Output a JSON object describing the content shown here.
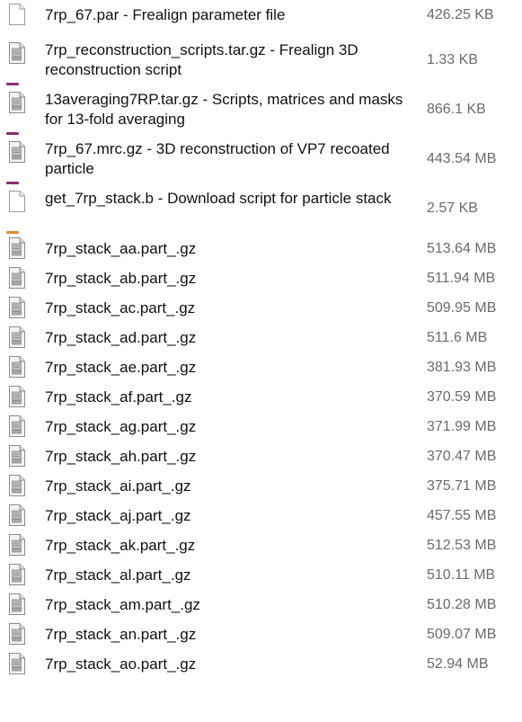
{
  "colors": {
    "text": "#111111",
    "size_text": "#6b6b6b",
    "mark_purple": "#8e2b73",
    "mark_orange": "#e08a2c"
  },
  "files": [
    {
      "name": "7rp_67.par - Frealign parameter file",
      "size": "426.25 KB",
      "icon": "blank-document-icon",
      "layout": "first",
      "mark": ""
    },
    {
      "name": "7rp_reconstruction_scripts.tar.gz - Frealign 3D reconstruction script",
      "size": "1.33 KB",
      "icon": "archive-file-icon",
      "layout": "double",
      "mark": "purple"
    },
    {
      "name": "13averaging7RP.tar.gz - Scripts, matrices and masks for 13-fold averaging",
      "size": "866.1 KB",
      "icon": "archive-file-icon",
      "layout": "double",
      "mark": "purple"
    },
    {
      "name": "7rp_67.mrc.gz - 3D reconstruction of VP7 recoated particle",
      "size": "443.54 MB",
      "icon": "archive-file-icon",
      "layout": "double",
      "mark": "purple"
    },
    {
      "name": "get_7rp_stack.b - Download script for particle stack",
      "size": "2.57 KB",
      "icon": "blank-document-icon",
      "layout": "double",
      "mark": "orange"
    },
    {
      "name": "7rp_stack_aa.part_.gz",
      "size": "513.64 MB",
      "icon": "archive-file-icon",
      "layout": "single",
      "mark": ""
    },
    {
      "name": "7rp_stack_ab.part_.gz",
      "size": "511.94 MB",
      "icon": "archive-file-icon",
      "layout": "single",
      "mark": ""
    },
    {
      "name": "7rp_stack_ac.part_.gz",
      "size": "509.95 MB",
      "icon": "archive-file-icon",
      "layout": "single",
      "mark": ""
    },
    {
      "name": "7rp_stack_ad.part_.gz",
      "size": "511.6 MB",
      "icon": "archive-file-icon",
      "layout": "single",
      "mark": ""
    },
    {
      "name": "7rp_stack_ae.part_.gz",
      "size": "381.93 MB",
      "icon": "archive-file-icon",
      "layout": "single",
      "mark": ""
    },
    {
      "name": "7rp_stack_af.part_.gz",
      "size": "370.59 MB",
      "icon": "archive-file-icon",
      "layout": "single",
      "mark": ""
    },
    {
      "name": "7rp_stack_ag.part_.gz",
      "size": "371.99 MB",
      "icon": "archive-file-icon",
      "layout": "single",
      "mark": ""
    },
    {
      "name": "7rp_stack_ah.part_.gz",
      "size": "370.47 MB",
      "icon": "archive-file-icon",
      "layout": "single",
      "mark": ""
    },
    {
      "name": "7rp_stack_ai.part_.gz",
      "size": "375.71 MB",
      "icon": "archive-file-icon",
      "layout": "single",
      "mark": ""
    },
    {
      "name": "7rp_stack_aj.part_.gz",
      "size": "457.55 MB",
      "icon": "archive-file-icon",
      "layout": "single",
      "mark": ""
    },
    {
      "name": "7rp_stack_ak.part_.gz",
      "size": "512.53 MB",
      "icon": "archive-file-icon",
      "layout": "single",
      "mark": ""
    },
    {
      "name": "7rp_stack_al.part_.gz",
      "size": "510.11 MB",
      "icon": "archive-file-icon",
      "layout": "single",
      "mark": ""
    },
    {
      "name": "7rp_stack_am.part_.gz",
      "size": "510.28 MB",
      "icon": "archive-file-icon",
      "layout": "single",
      "mark": ""
    },
    {
      "name": "7rp_stack_an.part_.gz",
      "size": "509.07 MB",
      "icon": "archive-file-icon",
      "layout": "single",
      "mark": ""
    },
    {
      "name": "7rp_stack_ao.part_.gz",
      "size": "52.94 MB",
      "icon": "archive-file-icon",
      "layout": "single",
      "mark": ""
    }
  ]
}
